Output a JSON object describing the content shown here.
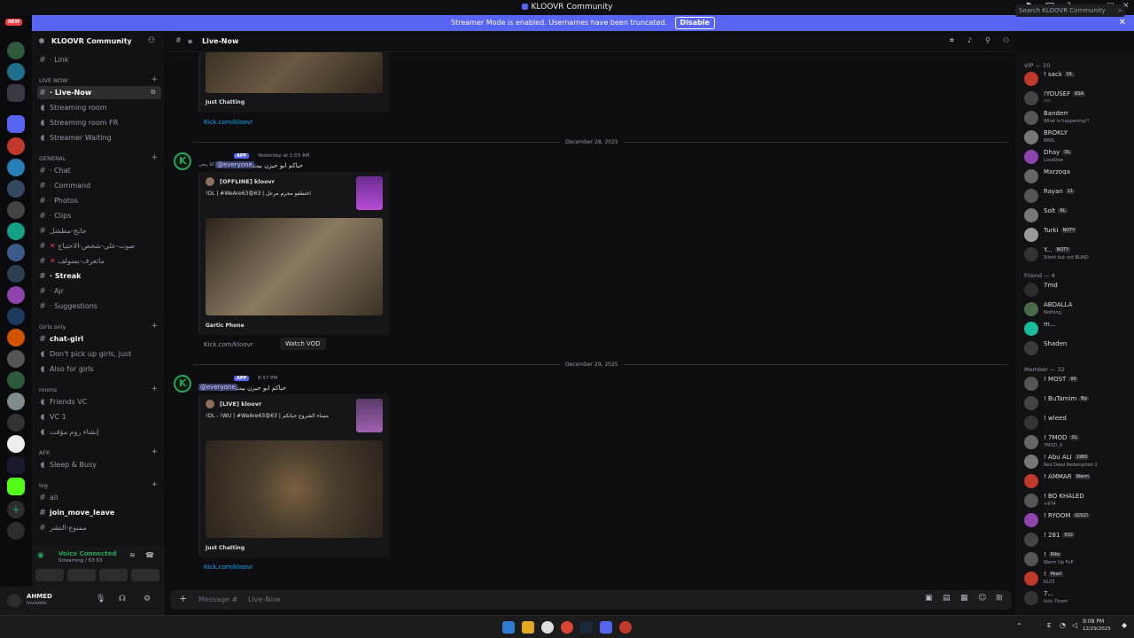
{
  "window": {
    "title": "KLOOVR Community"
  },
  "banner": {
    "text": "Streamer Mode is enabled. Usernames have been truncated.",
    "button": "Disable"
  },
  "rail": {
    "new_badge": "NEW"
  },
  "guild": {
    "name": "KLOOVR Community"
  },
  "channels": {
    "link": "· Link",
    "cat_live": "LIVE NOW",
    "live_now": "· Live-Now",
    "streaming_room": "Streaming room",
    "streaming_room_fr": "Streaming room FR",
    "streamer_waiting": "Streamer Waiting",
    "cat_general": "GENERAL",
    "chat": "· Chat",
    "command": "· Command",
    "photos": "· Photos",
    "clips": "· Clips",
    "ar1": "جايح-مطشل",
    "ar2": "صوت-علي-شخص-الاحتياج",
    "ar3": "ماتعرف-يسولف",
    "streak": "· Streak",
    "ajr": "· Ajr",
    "suggestions": "· Suggestions",
    "cat_girls": "Girls only",
    "chat_girl": "chat-girl",
    "dont_pick": "Don't pick up girls, just",
    "also_girls": "Also for girls",
    "cat_rooms": "rooms",
    "friends_vc": "Friends VC",
    "vc1": "VC 1",
    "ar_room": "إنشاء روم مؤقت",
    "cat_afk": "AFK",
    "sleep": "Sleep & Busy",
    "cat_log": "log",
    "all": "all",
    "join_move": "join_move_leave",
    "ar_log": "ممنوع-النشر"
  },
  "voice": {
    "status": "Voice Connected",
    "sub": "Streaming / 63 63"
  },
  "user": {
    "name": "AHMED",
    "status": "Invisible"
  },
  "header": {
    "channel": "Live-Now",
    "search_placeholder": "Search KLOOVR Community"
  },
  "chat": {
    "msg0": {
      "game": "Just Chatting",
      "link": "Kick.com/kloovr"
    },
    "date1": "December 28, 2025",
    "msg1": {
      "app": "APP",
      "time": "Yesterday at 1:03 AM",
      "tag": "كلا يبعي",
      "mention": "@everyone",
      "text": "حياكم ابو جيزن بيث",
      "embed_author": "[OFFLINE] kloovr",
      "embed_title": "!OL | #WeAre63😡63 | اختطفو مجرم مرعل",
      "game": "Gartic Phone",
      "link": "Kick.com/kloovr",
      "vod": "Watch VOD"
    },
    "date2": "December 29, 2025",
    "msg2": {
      "app": "APP",
      "time": "8:57 PM",
      "mention": "@everyone",
      "text": "حياكم ابو جيزن بيث",
      "embed_author": "[LIVE] kloovr",
      "embed_title": "!OL - !WU | #WeAre63😡63 | مساء الشروع حياتكم",
      "game": "Just Chatting",
      "link": "Kick.com/kloovr"
    },
    "input_placeholder": "Message #",
    "input_channel": "Live-Now"
  },
  "members": {
    "vip_head": "VIP — 10",
    "friend_head": "Friend — 4",
    "member_head": "Member — 32",
    "vip": [
      {
        "name": "! sack",
        "tag": "OL",
        "status": "",
        "color": "#c0392b"
      },
      {
        "name": "!YOUSEF",
        "tag": "KSA",
        "status": "!!!!",
        "color": "#444"
      },
      {
        "name": "Banderr",
        "tag": "",
        "status": "What is happening?!",
        "color": "#555"
      },
      {
        "name": "BROKLY",
        "tag": "",
        "status": "BRKL",
        "color": "#777"
      },
      {
        "name": "Dhay",
        "tag": "OL",
        "status": "LoveDee",
        "color": "#8e44ad"
      },
      {
        "name": "Marzoqa",
        "tag": "",
        "status": "",
        "color": "#666"
      },
      {
        "name": "Rayan",
        "tag": "11",
        "status": "",
        "color": "#555"
      },
      {
        "name": "Solt",
        "tag": "RL",
        "status": "",
        "color": "#777"
      },
      {
        "name": "Turki",
        "tag": "NOTY",
        "status": "",
        "color": "#999"
      },
      {
        "name": "Y...",
        "tag": "NOTY",
        "status": "Silent but not BLIND",
        "color": "#333"
      }
    ],
    "friends": [
      {
        "name": "7md",
        "status": "",
        "color": "#2b2d31"
      },
      {
        "name": "ABDALLA",
        "status": "Nothing,",
        "color": "#4a6b4a"
      },
      {
        "name": "m...",
        "status": "",
        "color": "#1abc9c"
      },
      {
        "name": "Shaden",
        "status": "",
        "color": "#3b3b3b"
      }
    ],
    "members": [
      {
        "name": "! MOST",
        "tag": "99",
        "status": "",
        "color": "#555"
      },
      {
        "name": "! BuTamim",
        "tag": "Bp",
        "status": "",
        "color": "#444"
      },
      {
        "name": "! wleed",
        "tag": "",
        "status": "",
        "color": "#333"
      },
      {
        "name": "! 7MOD",
        "tag": "OL",
        "status": "7MOD_X",
        "color": "#666"
      },
      {
        "name": "! Abu ALI",
        "tag": "1980",
        "status": "Red Dead Redemption 2",
        "color": "#777"
      },
      {
        "name": "! AMMAR",
        "tag": "Warm",
        "status": "",
        "color": "#c0392b"
      },
      {
        "name": "! BO KHALED",
        "tag": "",
        "status": "+974",
        "color": "#555"
      },
      {
        "name": "! RYOOM",
        "tag": "GOLD",
        "status": "",
        "color": "#8e44ad"
      },
      {
        "name": "! 281",
        "tag": "502",
        "status": "",
        "color": "#444"
      },
      {
        "name": "!",
        "tag": "Riko",
        "status": "Warm Up PvP",
        "color": "#555"
      },
      {
        "name": "!",
        "tag": "Pearl",
        "status": "KL03",
        "color": "#c0392b"
      },
      {
        "name": "7...",
        "tag": "",
        "status": "kick-7loom",
        "color": "#333"
      }
    ]
  },
  "taskbar": {
    "time": "9:08 PM",
    "date": "12/29/2025",
    "lang": "E"
  }
}
